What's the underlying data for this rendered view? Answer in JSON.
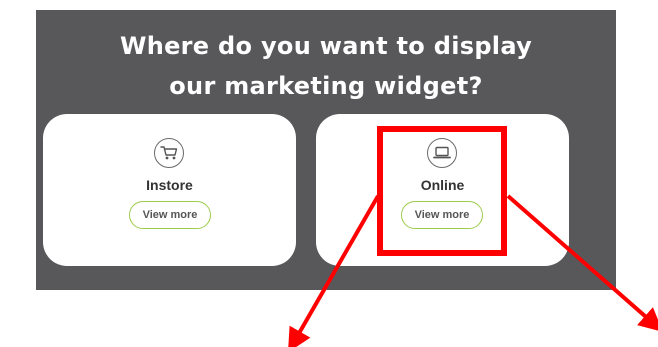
{
  "heading": {
    "line1": "Where do you want to display",
    "line2": "our marketing widget?"
  },
  "options": [
    {
      "label": "Instore",
      "icon": "shopping-cart-icon",
      "button_label": "View more"
    },
    {
      "label": "Online",
      "icon": "laptop-icon",
      "button_label": "View more"
    }
  ],
  "colors": {
    "panel_bg": "#58585a",
    "card_bg": "#ffffff",
    "button_border": "#9ccc4a",
    "annotation": "#ff0000"
  }
}
